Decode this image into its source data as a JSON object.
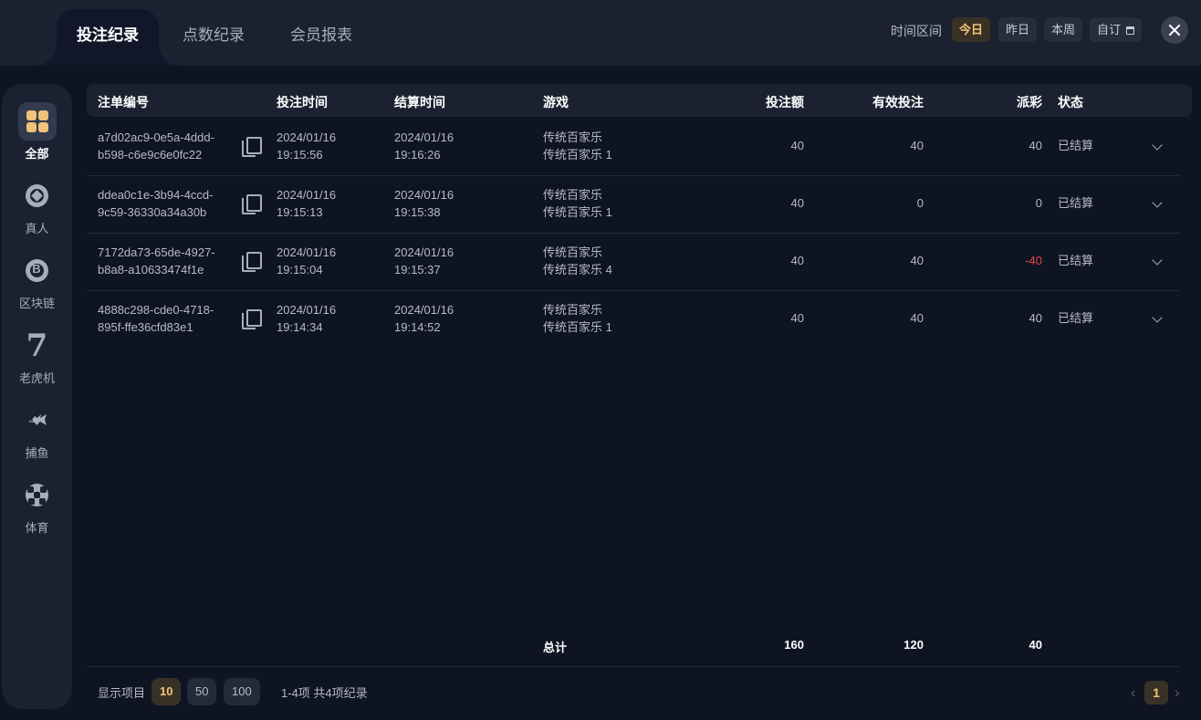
{
  "tabs": [
    "投注纪录",
    "点数纪录",
    "会员报表"
  ],
  "time_range": {
    "label": "时间区间",
    "options": [
      "今日",
      "昨日",
      "本周",
      "自订"
    ],
    "active": "今日"
  },
  "sidebar": {
    "items": [
      {
        "label": "全部",
        "icon": "grid-icon"
      },
      {
        "label": "真人",
        "icon": "casino-chip-icon"
      },
      {
        "label": "区块链",
        "icon": "bitcoin-icon"
      },
      {
        "label": "老虎机",
        "icon": "slot-seven-icon"
      },
      {
        "label": "捕鱼",
        "icon": "fish-icon"
      },
      {
        "label": "体育",
        "icon": "soccer-ball-icon"
      }
    ]
  },
  "table": {
    "headers": [
      "注单编号",
      "投注时间",
      "结算时间",
      "游戏",
      "投注额",
      "有效投注",
      "派彩",
      "状态"
    ],
    "rows": [
      {
        "id1": "a7d02ac9-0e5a-4ddd-",
        "id2": "b598-c6e9c6e0fc22",
        "bet_date": "2024/01/16",
        "bet_time": "19:15:56",
        "settle_date": "2024/01/16",
        "settle_time": "19:16:26",
        "game": "传统百家乐",
        "table": "传统百家乐 1",
        "amount": "40",
        "valid": "40",
        "payout": "40",
        "status": "已结算"
      },
      {
        "id1": "ddea0c1e-3b94-4ccd-",
        "id2": "9c59-36330a34a30b",
        "bet_date": "2024/01/16",
        "bet_time": "19:15:13",
        "settle_date": "2024/01/16",
        "settle_time": "19:15:38",
        "game": "传统百家乐",
        "table": "传统百家乐 1",
        "amount": "40",
        "valid": "0",
        "payout": "0",
        "status": "已结算"
      },
      {
        "id1": "7172da73-65de-4927-",
        "id2": "b8a8-a10633474f1e",
        "bet_date": "2024/01/16",
        "bet_time": "19:15:04",
        "settle_date": "2024/01/16",
        "settle_time": "19:15:37",
        "game": "传统百家乐",
        "table": "传统百家乐 4",
        "amount": "40",
        "valid": "40",
        "payout": "-40",
        "status": "已结算"
      },
      {
        "id1": "4888c298-cde0-4718-",
        "id2": "895f-ffe36cfd83e1",
        "bet_date": "2024/01/16",
        "bet_time": "19:14:34",
        "settle_date": "2024/01/16",
        "settle_time": "19:14:52",
        "game": "传统百家乐",
        "table": "传统百家乐 1",
        "amount": "40",
        "valid": "40",
        "payout": "40",
        "status": "已结算"
      }
    ],
    "total": {
      "label": "总计",
      "amount": "160",
      "valid": "120",
      "payout": "40"
    }
  },
  "footer": {
    "show_label": "显示项目",
    "page_sizes": [
      "10",
      "50",
      "100"
    ],
    "active_page_size": "10",
    "summary": "1-4项 共4项纪录",
    "current_page": "1"
  },
  "colors": {
    "accent": "#f2c476",
    "negative": "#e2463d",
    "background": "#0f1423",
    "panel": "#1b2131"
  }
}
